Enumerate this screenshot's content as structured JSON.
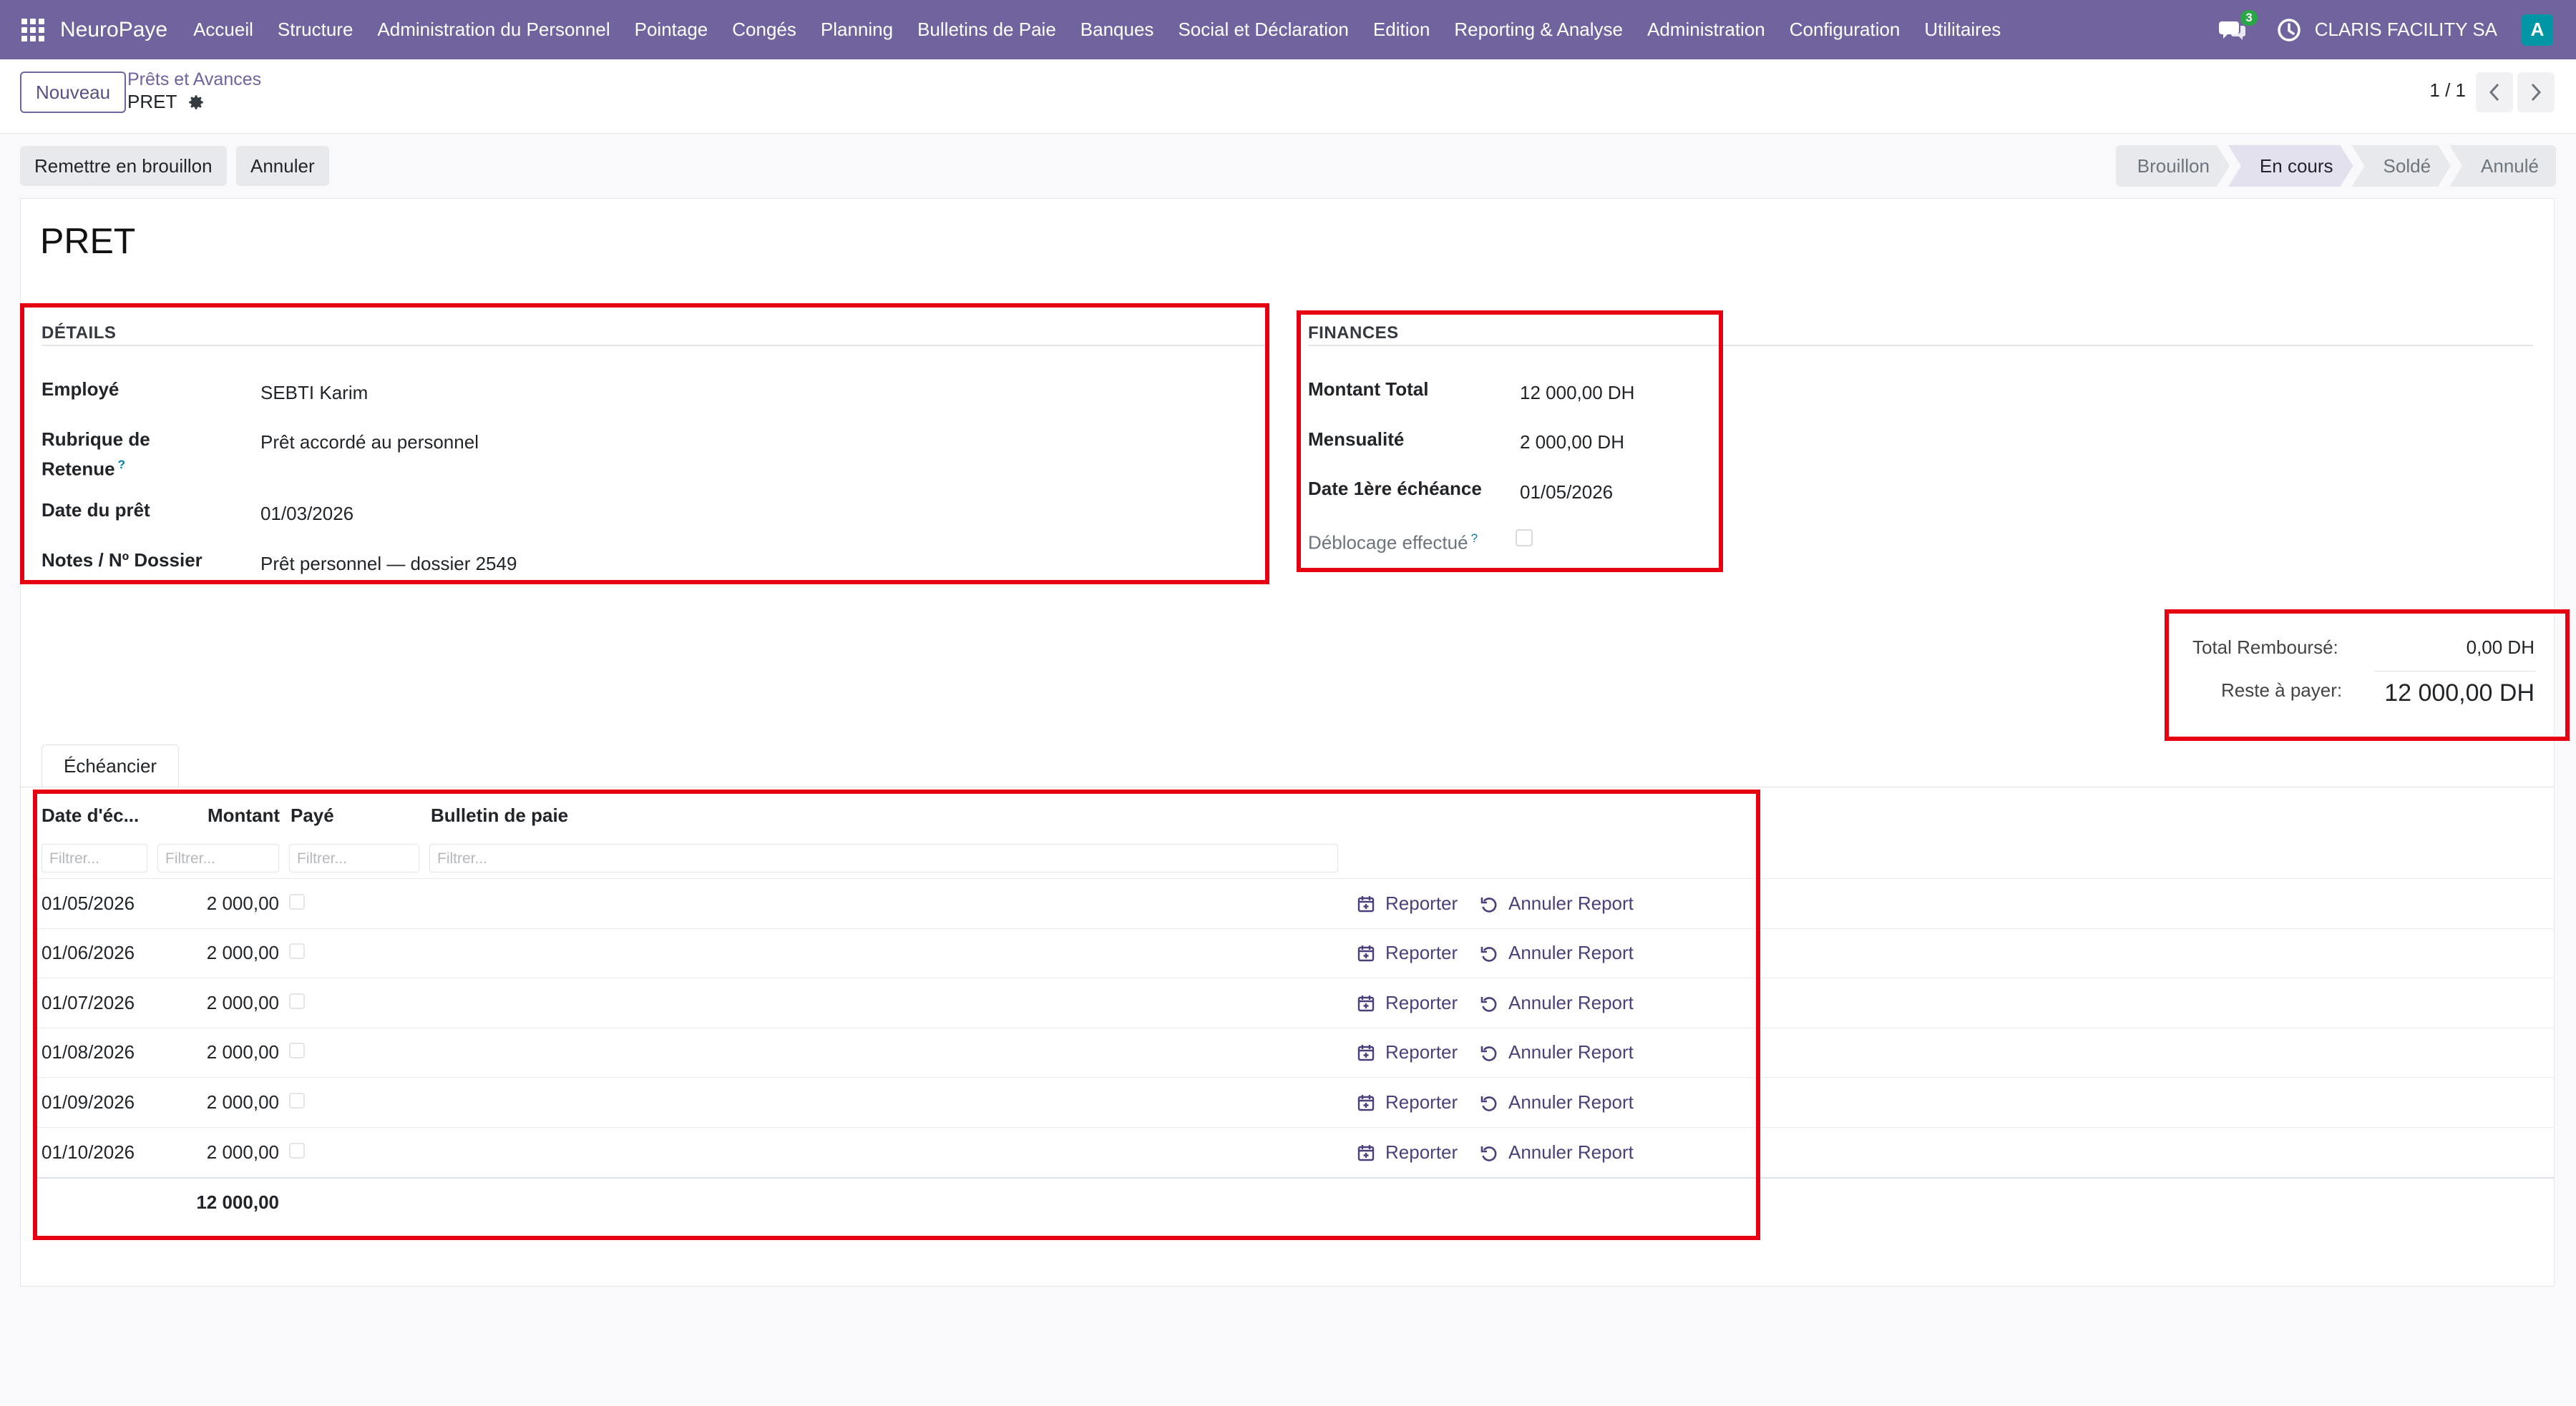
{
  "navbar": {
    "brand": "NeuroPaye",
    "menu": [
      "Accueil",
      "Structure",
      "Administration du Personnel",
      "Pointage",
      "Congés",
      "Planning",
      "Bulletins de Paie",
      "Banques",
      "Social et Déclaration",
      "Edition",
      "Reporting & Analyse",
      "Administration",
      "Configuration",
      "Utilitaires"
    ],
    "messages_count": "3",
    "company": "CLARIS FACILITY SA",
    "avatar_letter": "A"
  },
  "control": {
    "new_button": "Nouveau",
    "breadcrumb": "Prêts et Avances",
    "current": "PRET",
    "pager": "1 / 1"
  },
  "actions": {
    "reset_draft": "Remettre en brouillon",
    "cancel": "Annuler"
  },
  "statusbar": {
    "stages": [
      "Brouillon",
      "En cours",
      "Soldé",
      "Annulé"
    ],
    "active": "En cours"
  },
  "form": {
    "title": "PRET",
    "details": {
      "title": "DÉTAILS",
      "employee_label": "Employé",
      "employee_value": "SEBTI Karim",
      "rubrique_label_1": "Rubrique de",
      "rubrique_label_2": "Retenue",
      "rubrique_value": "Prêt accordé au personnel",
      "date_label": "Date du prêt",
      "date_value": "01/03/2026",
      "notes_label": "Notes / Nº Dossier",
      "notes_value": "Prêt personnel — dossier 2549"
    },
    "finances": {
      "title": "FINANCES",
      "total_label": "Montant Total",
      "total_value": "12 000,00 DH",
      "monthly_label": "Mensualité",
      "monthly_value": "2 000,00 DH",
      "first_due_label": "Date 1ère échéance",
      "first_due_value": "01/05/2026",
      "unlock_label": "Déblocage effectué",
      "unlock_checked": false
    },
    "totals": {
      "reimbursed_label": "Total Remboursé:",
      "reimbursed_value": "0,00 DH",
      "remaining_label": "Reste à payer:",
      "remaining_value": "12 000,00 DH"
    }
  },
  "notebook": {
    "tab": "Échéancier",
    "columns": [
      "Date d'éc...",
      "Montant",
      "Payé",
      "Bulletin de paie"
    ],
    "filter_placeholder": "Filtrer...",
    "report_label": "Reporter",
    "cancel_report_label": "Annuler Report",
    "rows": [
      {
        "date": "01/05/2026",
        "amount": "2 000,00",
        "paid": false,
        "payslip": ""
      },
      {
        "date": "01/06/2026",
        "amount": "2 000,00",
        "paid": false,
        "payslip": ""
      },
      {
        "date": "01/07/2026",
        "amount": "2 000,00",
        "paid": false,
        "payslip": ""
      },
      {
        "date": "01/08/2026",
        "amount": "2 000,00",
        "paid": false,
        "payslip": ""
      },
      {
        "date": "01/09/2026",
        "amount": "2 000,00",
        "paid": false,
        "payslip": ""
      },
      {
        "date": "01/10/2026",
        "amount": "2 000,00",
        "paid": false,
        "payslip": ""
      }
    ],
    "sum_amount": "12 000,00"
  },
  "colors": {
    "navbar": "#71639e",
    "accent": "#4c3f7a",
    "annotation": "#e60012"
  }
}
